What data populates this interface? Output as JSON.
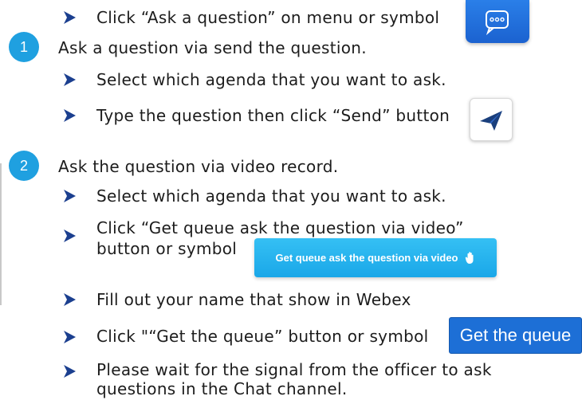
{
  "steps": {
    "intro": "Click “Ask a question” on menu or symbol",
    "s1_number": "1",
    "s1_title": "Ask a question via send the question.",
    "s1_a": "Select which agenda that you want to ask.",
    "s1_b": "Type the question then click “Send” button",
    "s2_number": "2",
    "s2_title": "Ask the question via video record.",
    "s2_a": "Select which agenda that you want to ask.",
    "s2_b_line1": "Click “Get queue ask the question via video”",
    "s2_b_line2": "button or symbol",
    "s2_c": "Fill out your name that show in Webex",
    "s2_d": "Click \"“Get the queue” button or symbol",
    "s2_e_line1": "Please wait for the signal from the officer to ask",
    "s2_e_line2": "questions in the Chat channel."
  },
  "buttons": {
    "video_label": "Get queue ask the question via video",
    "queue_label": "Get the queue"
  },
  "icons": {
    "chat": "chat-bubble-icon",
    "send": "paper-plane-icon",
    "hand": "raised-hand-icon",
    "bullet": "chevron-arrow-icon"
  },
  "colors": {
    "bullet": "#1b3f8f",
    "number_circle": "#1fa0e0",
    "chat_button": "#1b62d0",
    "video_button": "#1aa7e8",
    "queue_button": "#1d6fd6"
  }
}
